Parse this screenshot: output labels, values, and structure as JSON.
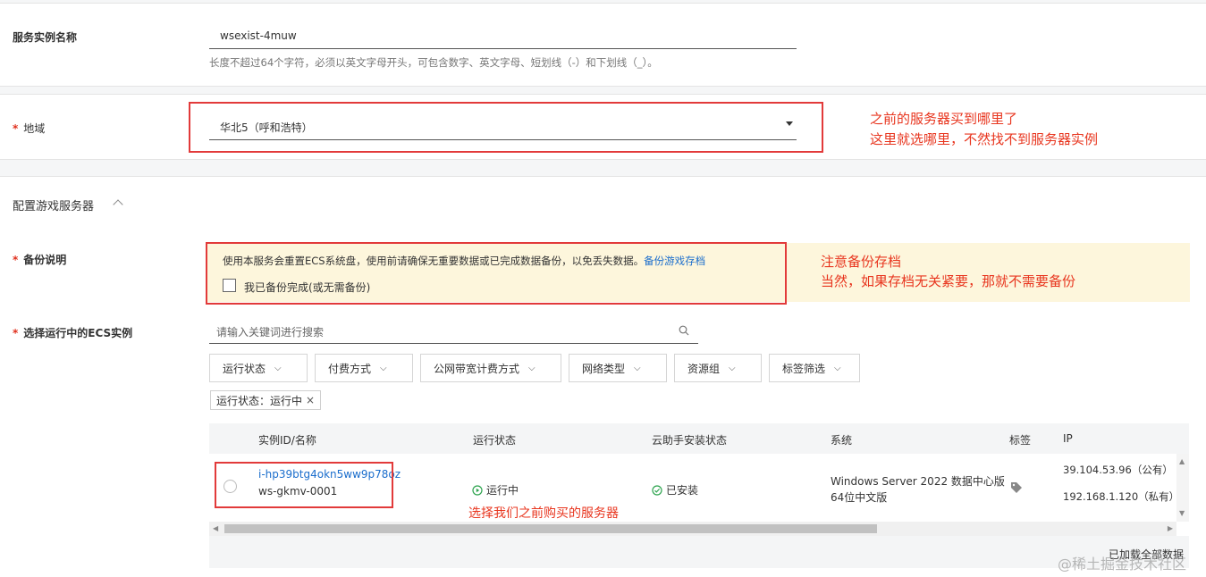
{
  "instance_name": {
    "label": "服务实例名称",
    "value": "wsexist-4muw",
    "hint": "长度不超过64个字符，必须以英文字母开头，可包含数字、英文字母、短划线（-）和下划线（_）。"
  },
  "region": {
    "required": "*",
    "label": "地域",
    "value": "华北5（呼和浩特）",
    "annotation_line1": "之前的服务器买到哪里了",
    "annotation_line2": "这里就选哪里，不然找不到服务器实例"
  },
  "config_section": {
    "title": "配置游戏服务器"
  },
  "backup": {
    "required": "*",
    "label": "备份说明",
    "notice": "使用本服务会重置ECS系统盘，使用前请确保无重要数据或已完成数据备份，以免丢失数据。",
    "notice_link": "备份游戏存档",
    "checkbox_label": "我已备份完成(或无需备份)",
    "checked": false,
    "annotation_line1": "注意备份存档",
    "annotation_line2": "当然，如果存档无关紧要，那就不需要备份"
  },
  "ecs": {
    "required": "*",
    "label": "选择运行中的ECS实例",
    "search_placeholder": "请输入关键词进行搜索",
    "filters": [
      "运行状态",
      "付费方式",
      "公网带宽计费方式",
      "网络类型",
      "资源组",
      "标签筛选"
    ],
    "active_tag": "运行状态：运行中",
    "columns": [
      "实例ID/名称",
      "运行状态",
      "云助手安装状态",
      "系统",
      "标签",
      "IP"
    ],
    "row": {
      "instance_id": "i-hp39btg4okn5ww9p78oz",
      "instance_name": "ws-gkmv-0001",
      "status": "运行中",
      "assistant_status": "已安装",
      "os_line1": "Windows Server 2022 数据中心版",
      "os_line2": "64位中文版",
      "ip_public": "39.104.53.96（公有）",
      "ip_private": "192.168.1.120（私有）"
    },
    "row_annotation": "选择我们之前购买的服务器",
    "footer_text": "已加载全部数据"
  },
  "watermark": "@稀土掘金技术社区",
  "colors": {
    "annotation_red": "#e8361f",
    "link_blue": "#1a6dcc",
    "notice_bg": "#fdf6dc",
    "success_green": "#2ea44f"
  }
}
